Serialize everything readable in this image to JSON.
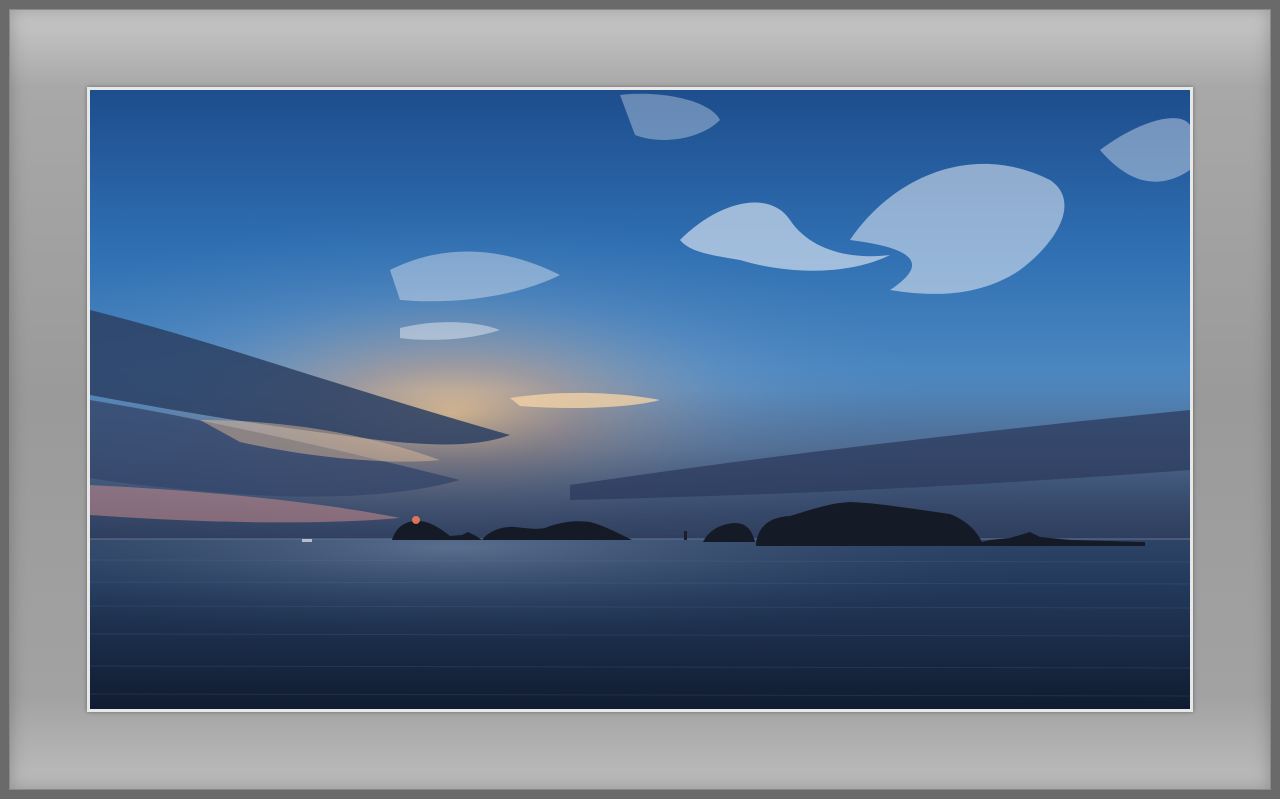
{
  "image": {
    "subject": "photograph",
    "colors": {
      "frame_outer": "#6a6a6a",
      "mat": "#a3a3a3",
      "sky_top": "#1f4f8c",
      "sky_mid": "#3c7ec0",
      "horizon_glow": "#f2a070",
      "sea": "#1a2c47",
      "silhouette": "#141a26"
    }
  }
}
